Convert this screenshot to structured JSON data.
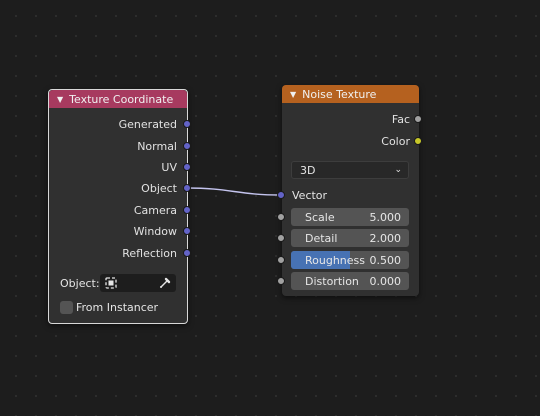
{
  "colors": {
    "texcoord_header": "#a73a5f",
    "noise_header": "#b5611f",
    "vector_socket": "#6363c7",
    "float_socket": "#a1a1a1",
    "color_socket": "#c7c729",
    "slider_fill": "#4772b3"
  },
  "texcoord": {
    "title": "Texture Coordinate",
    "outputs": [
      "Generated",
      "Normal",
      "UV",
      "Object",
      "Camera",
      "Window",
      "Reflection"
    ],
    "object_label": "Object:",
    "from_instancer_label": "From Instancer",
    "from_instancer_checked": false,
    "object_icon": "object-cube-icon",
    "picker_icon": "eyedropper-icon"
  },
  "noise": {
    "title": "Noise Texture",
    "outputs": [
      "Fac",
      "Color"
    ],
    "dimension": "3D",
    "vector_label": "Vector",
    "inputs": [
      {
        "label": "Scale",
        "value": "5.000"
      },
      {
        "label": "Detail",
        "value": "2.000"
      },
      {
        "label": "Roughness",
        "value": "0.500",
        "fill": 0.5
      },
      {
        "label": "Distortion",
        "value": "0.000"
      }
    ]
  }
}
